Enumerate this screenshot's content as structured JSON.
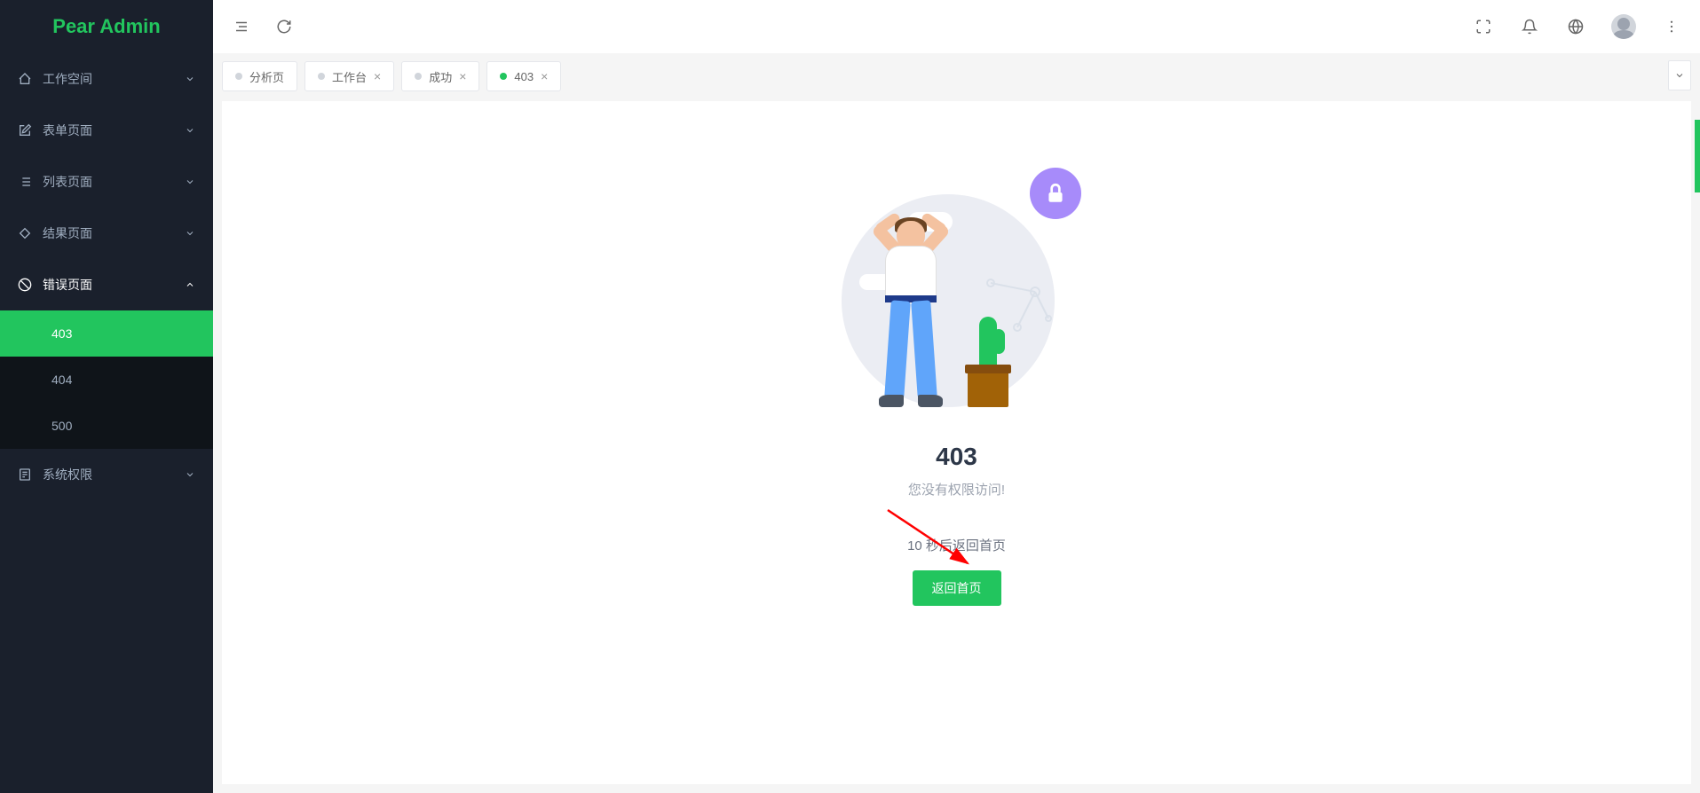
{
  "logo": "Pear Admin",
  "sidebar": {
    "items": [
      {
        "label": "工作空间",
        "icon": "home-icon"
      },
      {
        "label": "表单页面",
        "icon": "edit-icon"
      },
      {
        "label": "列表页面",
        "icon": "list-icon"
      },
      {
        "label": "结果页面",
        "icon": "tag-icon"
      },
      {
        "label": "错误页面",
        "icon": "block-icon"
      },
      {
        "label": "系统权限",
        "icon": "doc-icon"
      }
    ],
    "error_sub": [
      {
        "label": "403"
      },
      {
        "label": "404"
      },
      {
        "label": "500"
      }
    ]
  },
  "tabs": [
    {
      "label": "分析页"
    },
    {
      "label": "工作台"
    },
    {
      "label": "成功"
    },
    {
      "label": "403"
    }
  ],
  "error": {
    "title": "403",
    "subtitle": "您没有权限访问!",
    "countdown": "10 秒后返回首页",
    "button": "返回首页"
  }
}
